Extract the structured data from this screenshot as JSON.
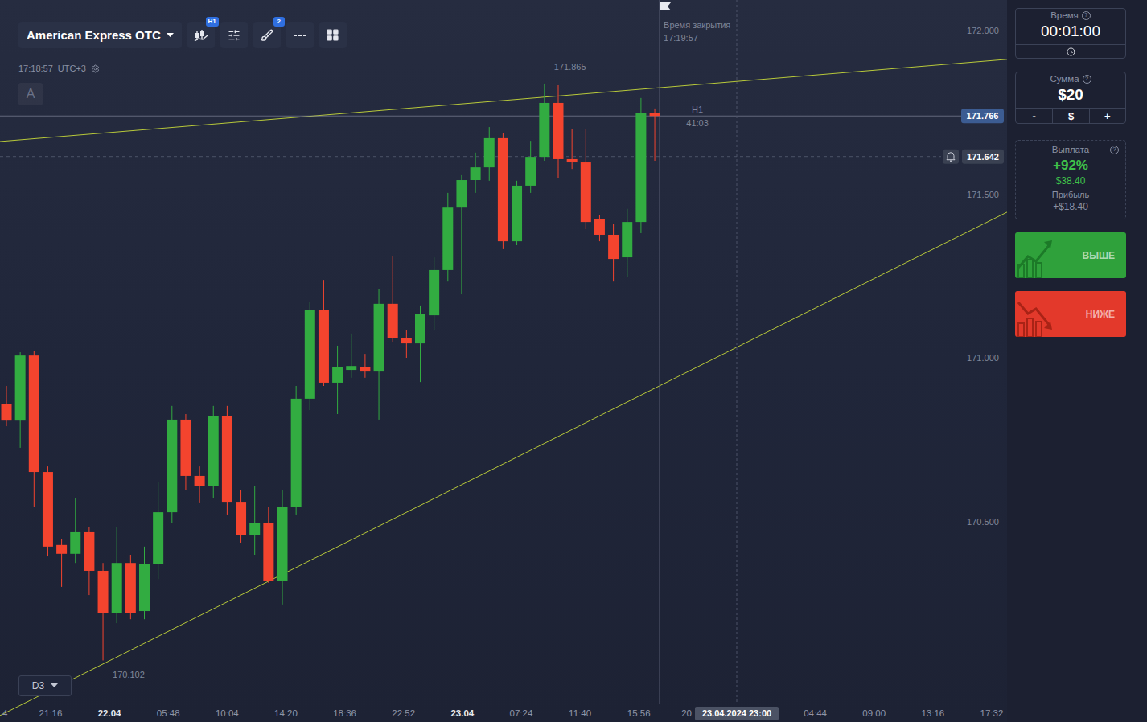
{
  "toolbar": {
    "asset": "American Express OTC",
    "tools": [
      {
        "kind": "chart-type",
        "badge": "H1"
      },
      {
        "kind": "indicators",
        "badge": null
      },
      {
        "kind": "drawings",
        "badge": "2"
      },
      {
        "kind": "line-style",
        "badge": null
      },
      {
        "kind": "layout",
        "badge": null
      }
    ]
  },
  "clock": {
    "time": "17:18:57",
    "zone": "UTC+3"
  },
  "drawing_label": "A",
  "timeframe": "D3",
  "chart": {
    "price_ticks": [
      "172.000",
      "171.500",
      "171.000",
      "170.500"
    ],
    "candles": {
      "open": [
        170.887,
        170.835,
        171.034,
        170.678,
        170.455,
        170.428,
        170.494,
        170.376,
        170.248,
        170.4,
        170.253,
        170.396,
        170.555,
        170.838,
        170.666,
        170.636,
        170.85,
        170.587,
        170.486,
        170.523,
        170.344,
        170.572,
        170.902,
        171.174,
        170.951,
        170.99,
        171.0,
        170.985,
        171.192,
        171.088,
        171.071,
        171.157,
        171.295,
        171.486,
        171.57,
        171.609,
        171.698,
        171.383,
        171.553,
        171.641,
        171.806,
        171.634,
        171.624,
        171.452,
        171.403,
        171.334,
        171.442,
        171.774
      ],
      "close": [
        170.835,
        171.034,
        170.678,
        170.45,
        170.428,
        170.494,
        170.376,
        170.248,
        170.4,
        170.248,
        170.396,
        170.555,
        170.838,
        170.666,
        170.636,
        170.85,
        170.587,
        170.486,
        170.523,
        170.344,
        170.572,
        170.902,
        171.174,
        170.951,
        170.998,
        171.002,
        170.985,
        171.192,
        171.088,
        171.071,
        171.162,
        171.295,
        171.486,
        171.57,
        171.609,
        171.698,
        171.383,
        171.553,
        171.641,
        171.806,
        171.634,
        171.624,
        171.442,
        171.403,
        171.329,
        171.442,
        171.774,
        171.766
      ],
      "high": [
        170.941,
        171.044,
        171.049,
        170.695,
        170.474,
        170.597,
        170.511,
        170.4,
        170.511,
        170.425,
        170.45,
        170.646,
        170.88,
        170.855,
        170.695,
        170.88,
        170.88,
        170.622,
        170.634,
        170.572,
        170.622,
        170.941,
        171.199,
        171.265,
        171.064,
        171.101,
        171.039,
        171.236,
        171.339,
        171.113,
        171.187,
        171.334,
        171.531,
        171.585,
        171.654,
        171.732,
        171.715,
        171.568,
        171.69,
        171.865,
        171.86,
        171.727,
        171.727,
        171.462,
        171.437,
        171.482,
        171.821,
        171.789
      ],
      "low": [
        170.818,
        170.752,
        170.572,
        170.42,
        170.327,
        170.4,
        170.302,
        170.102,
        170.216,
        170.228,
        170.228,
        170.351,
        170.523,
        170.622,
        170.585,
        170.597,
        170.548,
        170.462,
        170.425,
        170.339,
        170.273,
        170.548,
        170.867,
        170.941,
        170.855,
        170.966,
        170.966,
        170.838,
        171.076,
        171.027,
        170.953,
        171.113,
        171.26,
        171.221,
        171.531,
        171.568,
        171.359,
        171.371,
        171.531,
        171.629,
        171.575,
        171.604,
        171.42,
        171.383,
        171.26,
        171.273,
        171.408,
        171.629
      ]
    },
    "high_label": "171.865",
    "low_label": "170.102",
    "current_price": "171.766",
    "alert_price": "171.642",
    "timer": {
      "period": "H1",
      "remaining": "41:03"
    },
    "close_time": {
      "label": "Время закрытия",
      "time": "17:19:57"
    },
    "trend_lines": [
      {
        "start": 171.688,
        "end": 171.939
      },
      {
        "start": 169.934,
        "end": 171.472
      }
    ],
    "time_ticks": [
      {
        "label": "4",
        "kind": "cut"
      },
      {
        "label": "21:16",
        "kind": "time"
      },
      {
        "label": "22.04",
        "kind": "date"
      },
      {
        "label": "05:48",
        "kind": "time"
      },
      {
        "label": "10:04",
        "kind": "time"
      },
      {
        "label": "14:20",
        "kind": "time"
      },
      {
        "label": "18:36",
        "kind": "time"
      },
      {
        "label": "22:52",
        "kind": "time"
      },
      {
        "label": "23.04",
        "kind": "date"
      },
      {
        "label": "07:24",
        "kind": "time"
      },
      {
        "label": "11:40",
        "kind": "time"
      },
      {
        "label": "15:56",
        "kind": "time"
      },
      {
        "label": "20",
        "kind": "cut"
      },
      {
        "label": "23.04.2024 23:00",
        "kind": "cursor"
      },
      {
        "label": "04:44",
        "kind": "time"
      },
      {
        "label": "09:00",
        "kind": "time"
      },
      {
        "label": "13:16",
        "kind": "time"
      },
      {
        "label": "17:32",
        "kind": "time"
      }
    ]
  },
  "sidebar": {
    "time": {
      "label": "Время",
      "help": "?",
      "value": "00:01:00"
    },
    "amount": {
      "label": "Сумма",
      "help": "?",
      "value": "$20",
      "buttons": [
        "-",
        "$",
        "+"
      ]
    },
    "payout": {
      "label": "Выплата",
      "help": "?",
      "percent": "+92%",
      "amount": "$38.40",
      "profit_label": "Прибыль",
      "profit": "+$18.40"
    },
    "actions": [
      {
        "label": "ВЫШЕ",
        "kind": "up"
      },
      {
        "label": "НИЖЕ",
        "kind": "down"
      }
    ]
  }
}
